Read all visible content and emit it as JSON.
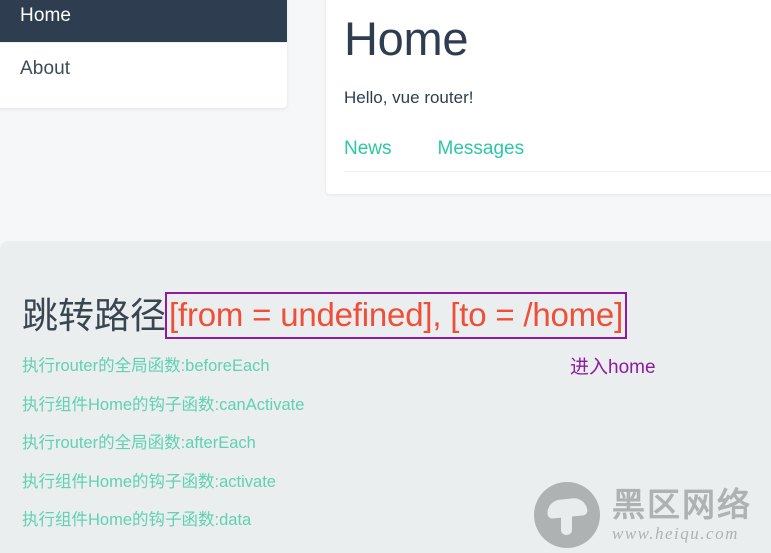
{
  "sidebar": {
    "items": [
      {
        "label": "Home",
        "active": true
      },
      {
        "label": "About",
        "active": false
      }
    ]
  },
  "content": {
    "title": "Home",
    "greeting": "Hello, vue router!",
    "tabs": [
      {
        "label": "News"
      },
      {
        "label": "Messages"
      }
    ]
  },
  "log_panel": {
    "route_label": "跳转路径",
    "route_value": "[from = undefined], [to = /home]",
    "route_value_color": "#ef4e37",
    "route_box_border_color": "#8e1b9e",
    "entries": [
      "执行router的全局函数:beforeEach",
      "执行组件Home的钩子函数:canActivate",
      "执行router的全局函数:afterEach",
      "执行组件Home的钩子函数:activate",
      "执行组件Home的钩子函数:data"
    ],
    "entry_color": "#60d1b3",
    "enter_note": "进入home",
    "enter_note_color": "#8e1b9e"
  },
  "watermark": {
    "name_cn": "黑区网络",
    "url": "www.heiqu.com",
    "logo_icon": "mushroom-icon"
  },
  "theme": {
    "accent_teal": "#2ec7a5",
    "dark_navy": "#2e3e50",
    "page_bg": "#f6f7f9",
    "panel_bg": "#eaeeee"
  }
}
